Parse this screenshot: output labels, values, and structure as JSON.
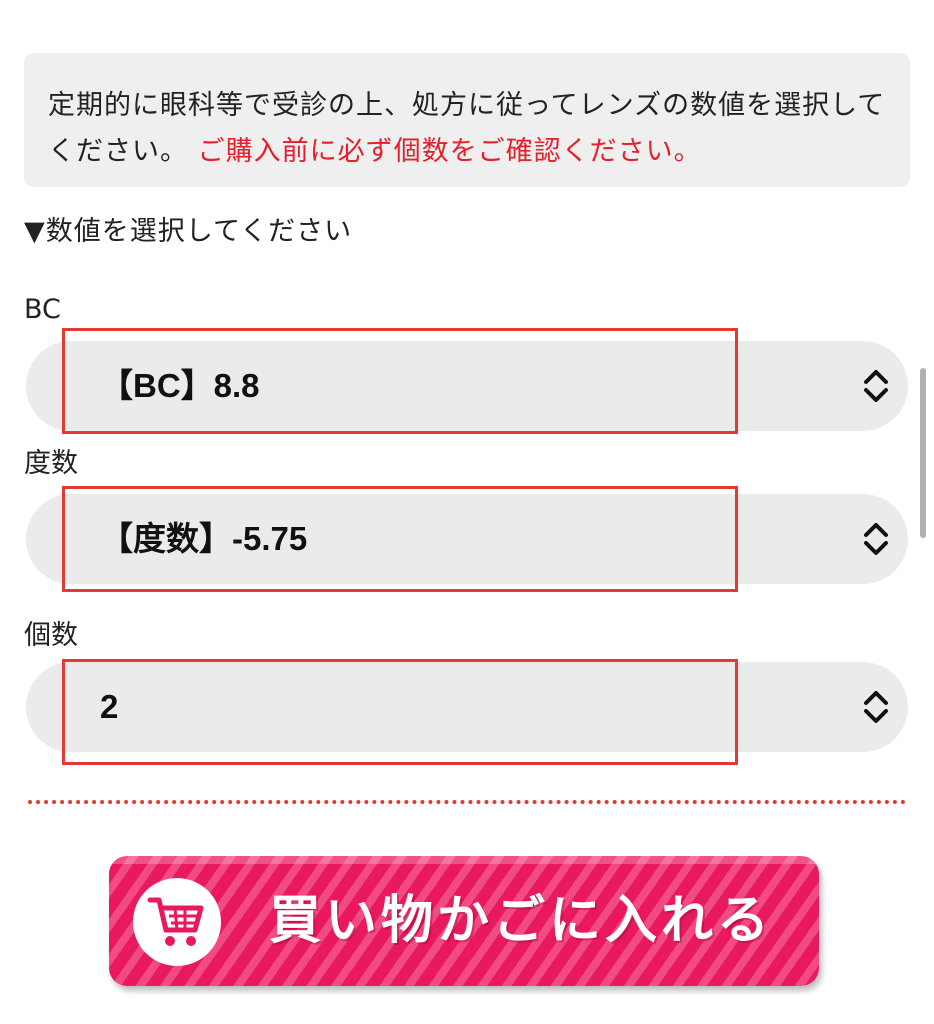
{
  "notice": {
    "text": "定期的に眼科等で受診の上、処方に従ってレンズの数値を選択してください。",
    "warning": "ご購入前に必ず個数をご確認ください。"
  },
  "section_title": "▼数値を選択してください",
  "fields": {
    "bc": {
      "label": "BC",
      "value": "【BC】8.8"
    },
    "power": {
      "label": "度数",
      "value": "【度数】-5.75"
    },
    "quantity": {
      "label": "個数",
      "value": "2"
    }
  },
  "cart_button": {
    "label": "買い物かごに入れる",
    "icon": "shopping-cart-icon"
  },
  "colors": {
    "warning": "#e5202b",
    "highlight": "#e53935",
    "button": "#e8195e",
    "select_bg": "#ebebeb",
    "notice_bg": "#efefef"
  }
}
